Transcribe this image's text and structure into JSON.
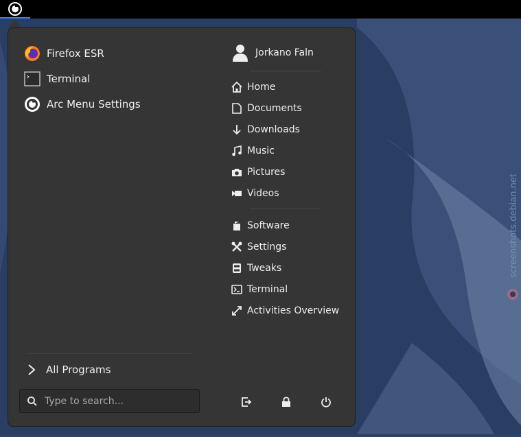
{
  "topbar": {
    "arc_icon": "arc-menu-icon"
  },
  "favorites": [
    {
      "label": "Firefox ESR",
      "icon": "firefox-icon"
    },
    {
      "label": "Terminal",
      "icon": "terminal-app-icon"
    },
    {
      "label": "Arc Menu Settings",
      "icon": "arc-menu-icon"
    }
  ],
  "all_programs": {
    "label": "All Programs",
    "icon": "chevron-right-icon"
  },
  "search": {
    "placeholder": "Type to search...",
    "value": "",
    "icon": "search-icon"
  },
  "user": {
    "name": "Jorkano Faln",
    "icon": "user-icon"
  },
  "places": [
    {
      "label": "Home",
      "icon": "home-icon"
    },
    {
      "label": "Documents",
      "icon": "document-icon"
    },
    {
      "label": "Downloads",
      "icon": "download-icon"
    },
    {
      "label": "Music",
      "icon": "music-icon"
    },
    {
      "label": "Pictures",
      "icon": "camera-icon"
    },
    {
      "label": "Videos",
      "icon": "video-icon"
    }
  ],
  "system": [
    {
      "label": "Software",
      "icon": "software-icon"
    },
    {
      "label": "Settings",
      "icon": "settings-icon"
    },
    {
      "label": "Tweaks",
      "icon": "tweaks-icon"
    },
    {
      "label": "Terminal",
      "icon": "terminal-icon"
    },
    {
      "label": "Activities Overview",
      "icon": "expand-icon"
    }
  ],
  "power": [
    {
      "name": "logout-button",
      "icon": "logout-icon"
    },
    {
      "name": "lock-button",
      "icon": "lock-icon"
    },
    {
      "name": "power-button",
      "icon": "power-icon"
    }
  ],
  "watermark": {
    "text": "screenshots.debian.net"
  },
  "colors": {
    "menu_bg": "#353535",
    "accent": "#3584e4",
    "desktop": "#2e4166"
  }
}
